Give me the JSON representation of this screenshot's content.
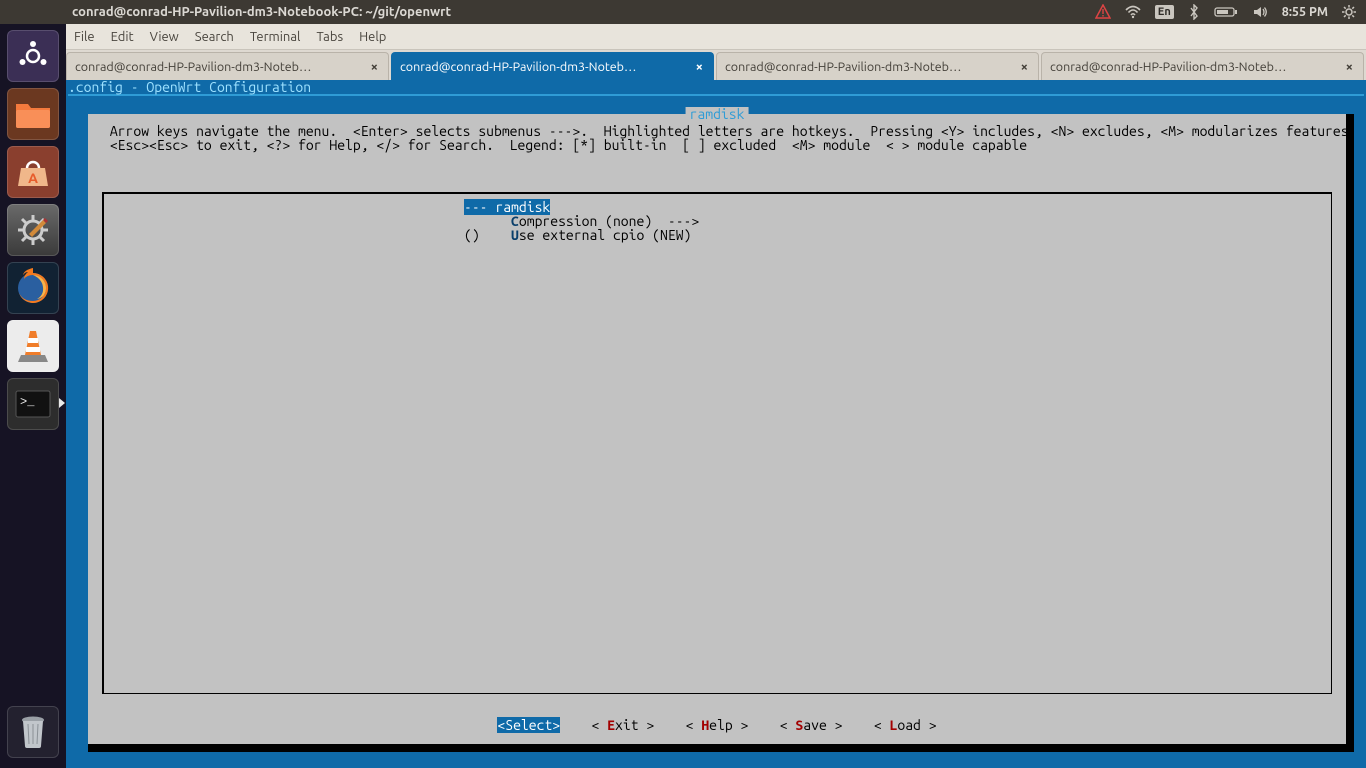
{
  "panel": {
    "title": "conrad@conrad-HP-Pavilion-dm3-Notebook-PC: ~/git/openwrt",
    "lang": "En",
    "time": "8:55 PM"
  },
  "menubar": {
    "items": [
      "File",
      "Edit",
      "View",
      "Search",
      "Terminal",
      "Tabs",
      "Help"
    ]
  },
  "tabs": [
    {
      "label": "conrad@conrad-HP-Pavilion-dm3-Noteb…",
      "active": false
    },
    {
      "label": "conrad@conrad-HP-Pavilion-dm3-Noteb…",
      "active": true
    },
    {
      "label": "conrad@conrad-HP-Pavilion-dm3-Noteb…",
      "active": false
    },
    {
      "label": "conrad@conrad-HP-Pavilion-dm3-Noteb…",
      "active": false
    }
  ],
  "terminal": {
    "headerline": " .config - OpenWrt Configuration",
    "section_title": "ramdisk",
    "instructions_line1": " Arrow keys navigate the menu.  <Enter> selects submenus --->.  Highlighted letters are hotkeys.  Pressing <Y> includes, <N> excludes, <M> modularizes features.  Press",
    "instructions_line2": " <Esc><Esc> to exit, <?> for Help, </> for Search.  Legend: [*] built-in  [ ] excluded  <M> module  < > module capable",
    "menu": [
      {
        "prefix": "--- ",
        "hot": "",
        "text": "ramdisk",
        "selected": true
      },
      {
        "prefix": "      ",
        "hot": "C",
        "text": "ompression (none)  --->",
        "selected": false
      },
      {
        "prefix": "()    ",
        "hot": "U",
        "text": "se external cpio (NEW)",
        "selected": false
      }
    ],
    "buttons": {
      "select": "<Select>",
      "exit_l": "< ",
      "exit_k": "E",
      "exit_r": "xit >",
      "help_l": "< ",
      "help_k": "H",
      "help_r": "elp >",
      "save_l": "< ",
      "save_k": "S",
      "save_r": "ave >",
      "load_l": "< ",
      "load_k": "L",
      "load_r": "oad >"
    }
  },
  "launcher": {
    "items": [
      {
        "name": "dash-icon",
        "bg": "#5b4a79"
      },
      {
        "name": "files-icon",
        "bg": "#e75d2c"
      },
      {
        "name": "software-center-icon",
        "bg": "#d7664b"
      },
      {
        "name": "settings-icon",
        "bg": "#555555"
      },
      {
        "name": "firefox-icon",
        "bg": "#1075c1"
      },
      {
        "name": "vlc-icon",
        "bg": "#eaeaea"
      },
      {
        "name": "terminal-icon",
        "bg": "#2f2f2f"
      }
    ],
    "trash": {
      "name": "trash-icon",
      "bg": "rgba(80,80,90,.4)"
    }
  }
}
